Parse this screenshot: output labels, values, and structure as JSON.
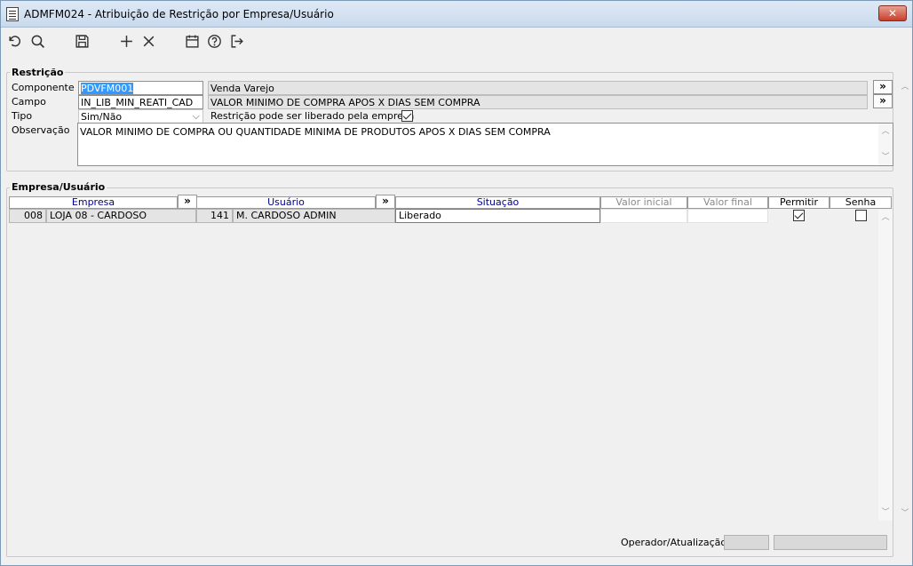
{
  "window": {
    "title": "ADMFM024 - Atribuição de Restrição por Empresa/Usuário",
    "close_label": "✕"
  },
  "toolbar": {
    "items": [
      "refresh-icon",
      "search-icon",
      "save-icon",
      "add-icon",
      "delete-icon",
      "calendar-icon",
      "help-icon",
      "exit-icon"
    ]
  },
  "restricao": {
    "legend": "Restrição",
    "componente_label": "Componente",
    "componente_value": "PDVFM001",
    "componente_desc": "Venda Varejo",
    "campo_label": "Campo",
    "campo_value": "IN_LIB_MIN_REATI_CAD",
    "campo_desc": "VALOR MINIMO DE COMPRA APOS X DIAS SEM COMPRA",
    "tipo_label": "Tipo",
    "tipo_value": "Sim/Não",
    "liberado_label": "Restrição pode ser liberado pela empresa",
    "liberado_checked": true,
    "observacao_label": "Observação",
    "observacao_value": "VALOR MINIMO DE COMPRA OU QUANTIDADE MINIMA DE PRODUTOS APOS X DIAS SEM COMPRA",
    "ext_button": "»"
  },
  "empresa_usuario": {
    "legend": "Empresa/Usuário",
    "columns": {
      "empresa": "Empresa",
      "usuario": "Usuário",
      "situacao": "Situação",
      "valor_inicial": "Valor inicial",
      "valor_final": "Valor final",
      "permitir": "Permitir",
      "senha": "Senha"
    },
    "col_button": "»",
    "rows": [
      {
        "empresa_code": "008",
        "empresa_name": "LOJA 08 - CARDOSO",
        "usuario_code": "141",
        "usuario_name": "M. CARDOSO ADMIN",
        "situacao": "Liberado",
        "valor_inicial": "",
        "valor_final": "",
        "permitir": true,
        "senha": false
      }
    ]
  },
  "footer": {
    "operador_label": "Operador/Atualização",
    "operador_value": "",
    "atualizacao_value": ""
  },
  "colors": {
    "header_blue": "#00008b",
    "selection": "#3399ff",
    "readonly_bg": "#e4e4e4",
    "close_red": "#c7402a"
  }
}
